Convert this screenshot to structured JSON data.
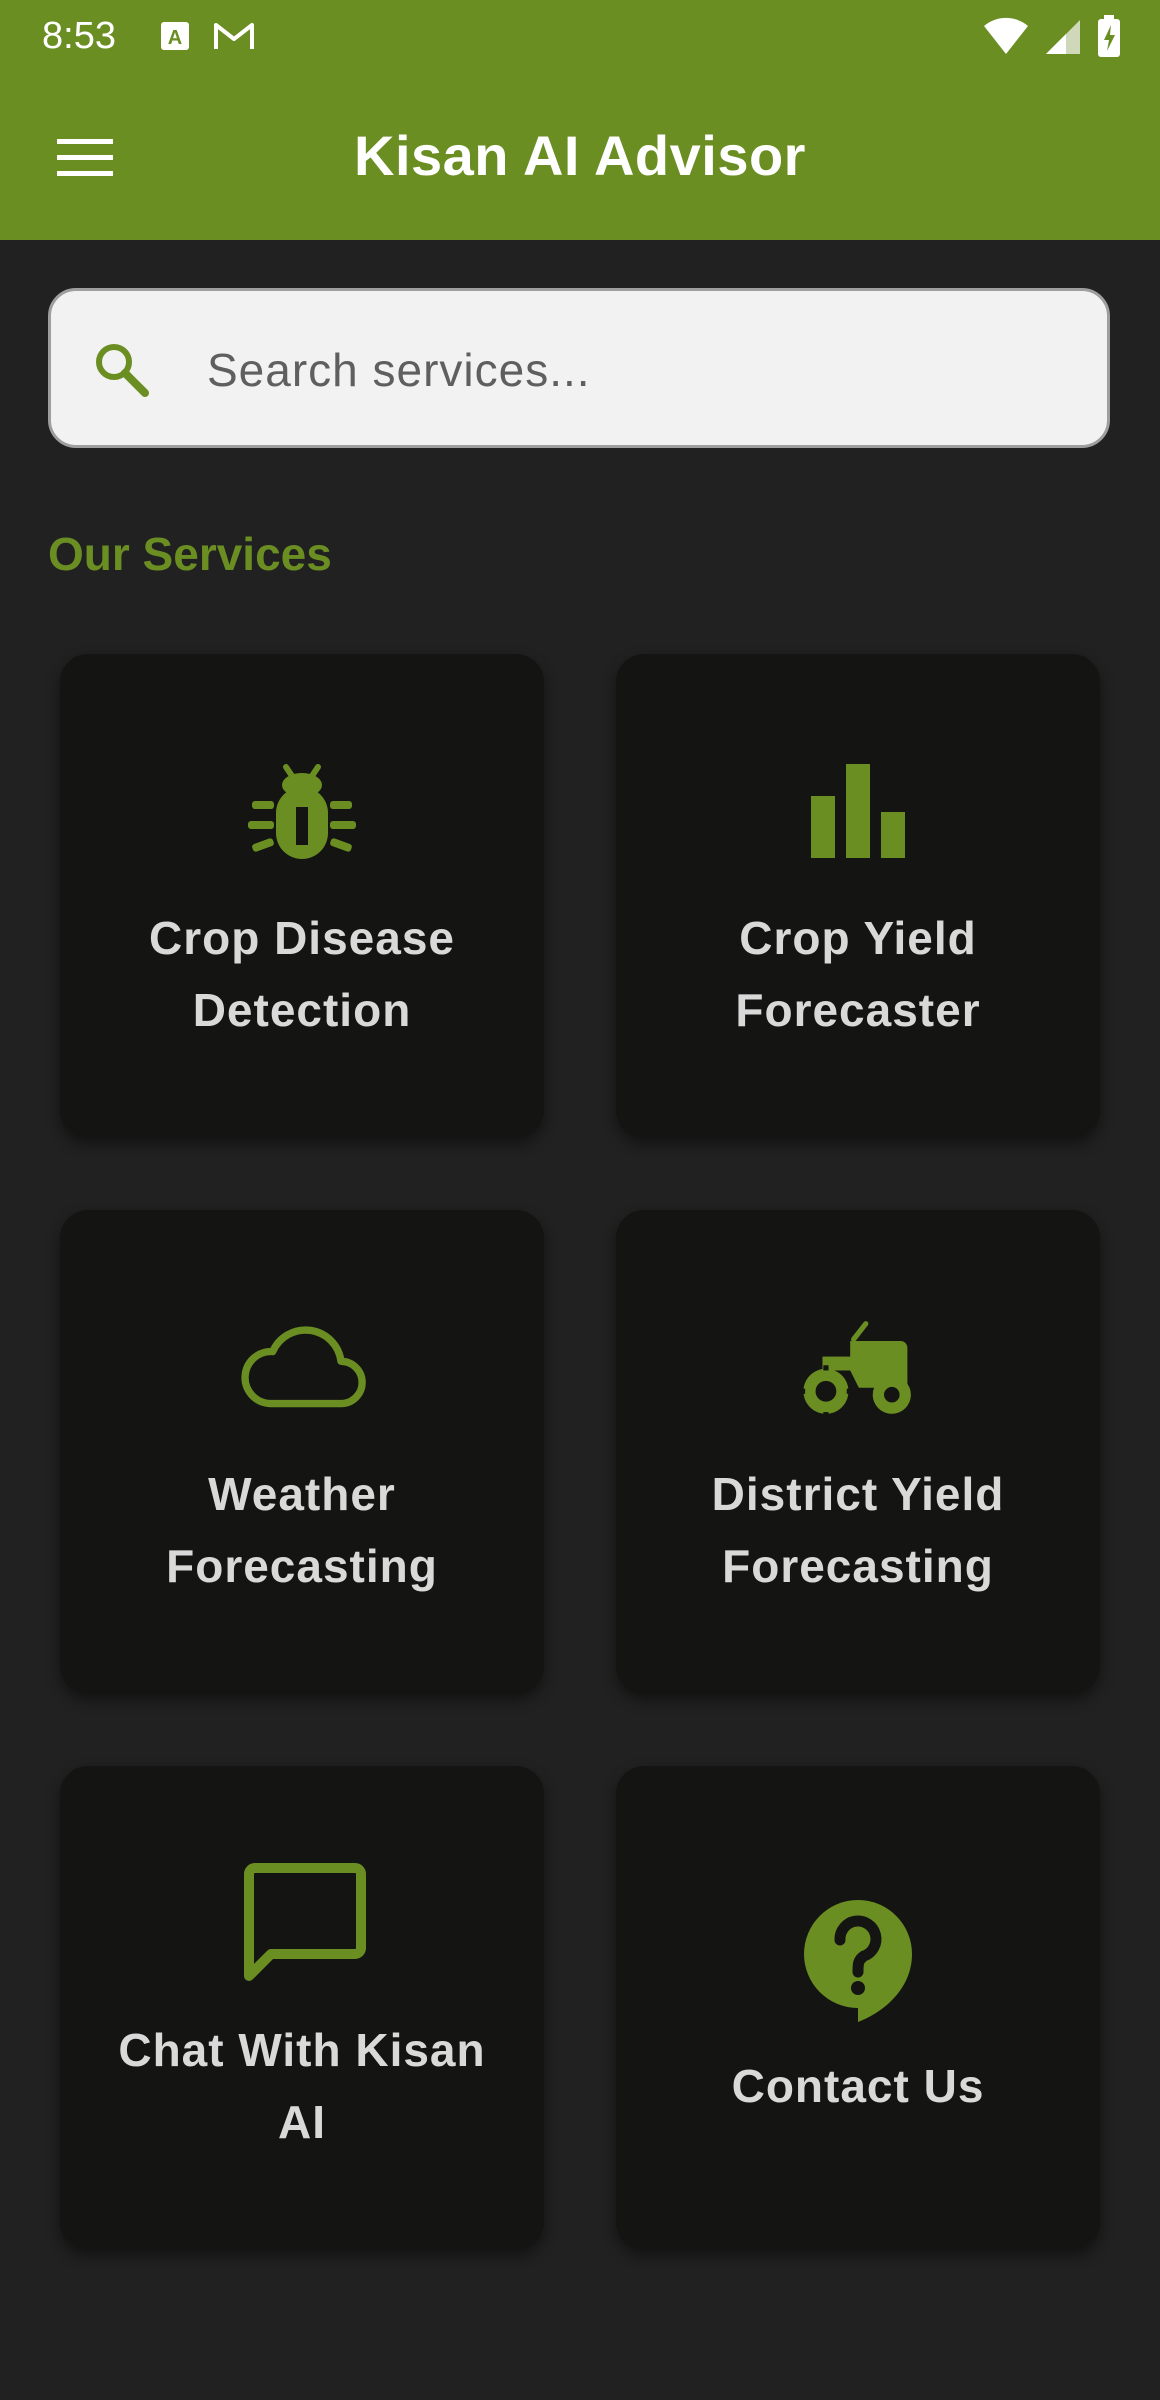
{
  "status_bar": {
    "time": "8:53"
  },
  "app_bar": {
    "title": "Kisan AI Advisor"
  },
  "search": {
    "placeholder": "Search services...",
    "value": ""
  },
  "services": {
    "heading": "Our Services",
    "items": [
      {
        "label": "Crop Disease Detection",
        "icon": "bug-icon"
      },
      {
        "label": "Crop Yield Forecaster",
        "icon": "bar-chart-icon"
      },
      {
        "label": "Weather Forecasting",
        "icon": "cloud-icon"
      },
      {
        "label": "District Yield Forecasting",
        "icon": "tractor-icon"
      },
      {
        "label": "Chat With Kisan AI",
        "icon": "chat-icon"
      },
      {
        "label": "Contact Us",
        "icon": "help-icon"
      }
    ]
  },
  "colors": {
    "primary": "#6b8e23",
    "background": "#212121",
    "card": "#141512",
    "card_text": "#d9d9d9"
  }
}
